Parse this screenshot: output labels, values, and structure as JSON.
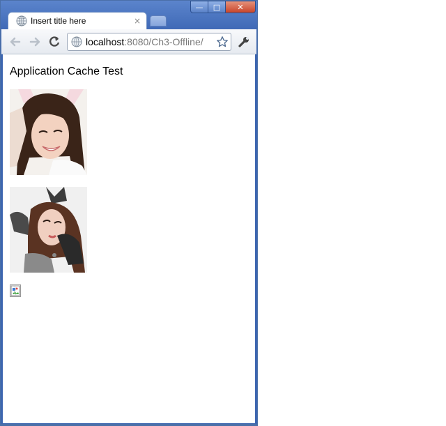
{
  "tab": {
    "title": "Insert title here",
    "close_glyph": "×"
  },
  "address": {
    "host": "localhost",
    "rest": ":8080/Ch3-Offline/"
  },
  "page": {
    "heading": "Application Cache Test"
  },
  "window_controls": {
    "minimize": "—",
    "maximize": "□",
    "close": "✕"
  },
  "icons": [
    "globe-icon",
    "back-arrow-icon",
    "forward-arrow-icon",
    "reload-icon",
    "star-icon",
    "wrench-icon",
    "broken-image-icon"
  ],
  "colors": {
    "frame": "#3d66b0",
    "toolbar": "#e6eaf0"
  }
}
